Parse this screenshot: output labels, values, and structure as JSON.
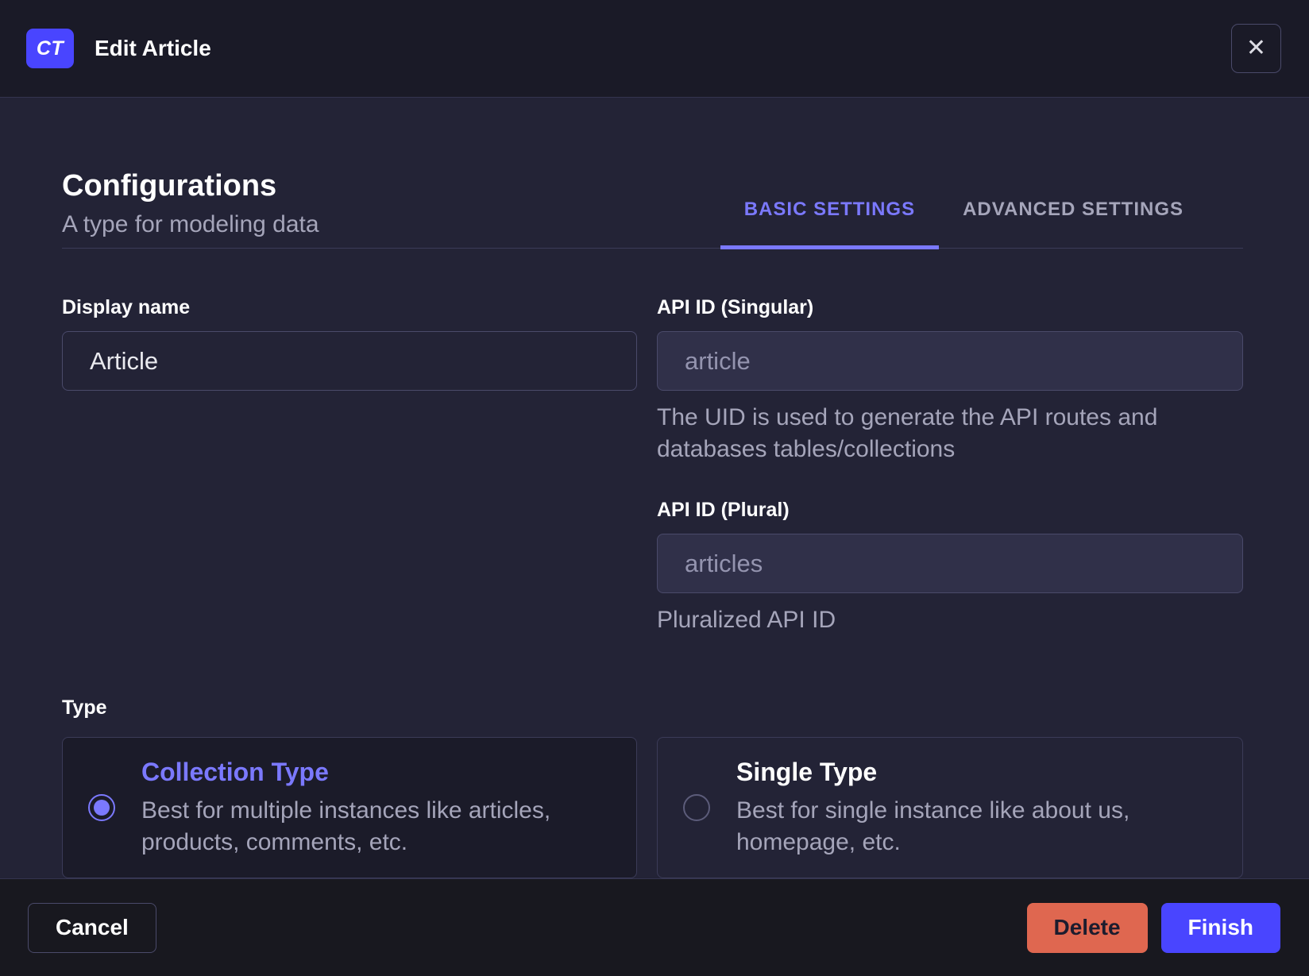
{
  "header": {
    "badge": "CT",
    "title": "Edit Article"
  },
  "icons": {
    "close": "✕"
  },
  "section": {
    "title": "Configurations",
    "subtitle": "A type for modeling data"
  },
  "tabs": [
    {
      "label": "BASIC SETTINGS",
      "active": true
    },
    {
      "label": "ADVANCED SETTINGS",
      "active": false
    }
  ],
  "form": {
    "display_name": {
      "label": "Display name",
      "value": "Article"
    },
    "api_id_singular": {
      "label": "API ID (Singular)",
      "placeholder": "article",
      "help": "The UID is used to generate the API routes and databases tables/collections"
    },
    "api_id_plural": {
      "label": "API ID (Plural)",
      "placeholder": "articles",
      "help": "Pluralized API ID"
    },
    "type": {
      "label": "Type",
      "options": [
        {
          "title": "Collection Type",
          "description": "Best for multiple instances like articles, products, comments, etc.",
          "selected": true
        },
        {
          "title": "Single Type",
          "description": "Best for single instance like about us, homepage, etc.",
          "selected": false
        }
      ]
    }
  },
  "footer": {
    "cancel_label": "Cancel",
    "delete_label": "Delete",
    "finish_label": "Finish"
  },
  "colors": {
    "accent": "#7b79ff",
    "primary": "#4945ff",
    "danger": "#df6750",
    "header_bg": "#1a1a27",
    "body_bg": "#232336",
    "footer_bg": "#18181f"
  }
}
